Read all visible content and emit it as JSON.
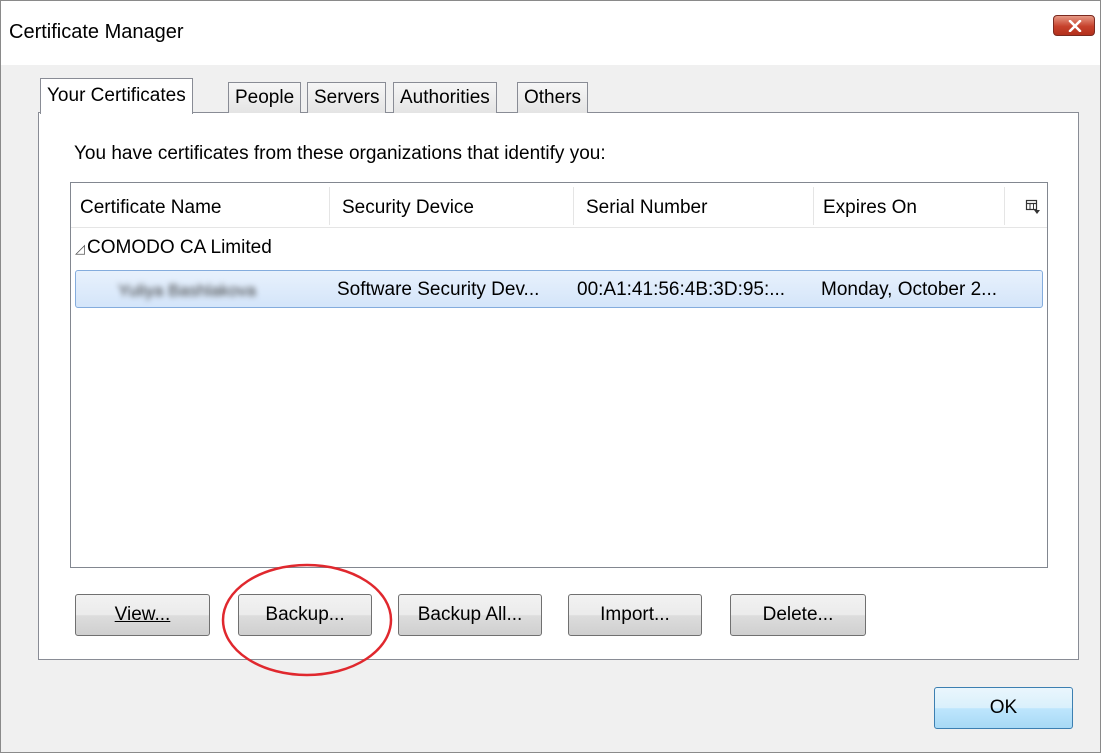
{
  "window": {
    "title": "Certificate Manager"
  },
  "tabs": [
    {
      "label": "Your Certificates",
      "active": true
    },
    {
      "label": "People",
      "active": false
    },
    {
      "label": "Servers",
      "active": false
    },
    {
      "label": "Authorities",
      "active": false
    },
    {
      "label": "Others",
      "active": false
    }
  ],
  "intro_text": "You have certificates from these organizations that identify you:",
  "table": {
    "columns": [
      "Certificate Name",
      "Security Device",
      "Serial Number",
      "Expires On"
    ],
    "groups": [
      {
        "name": "COMODO CA Limited",
        "expanded": true,
        "rows": [
          {
            "certificate_name": "Yuliya Bashlakova",
            "certificate_name_obscured": true,
            "security_device": "Software Security Dev...",
            "serial_number": "00:A1:41:56:4B:3D:95:...",
            "expires_on": "Monday, October 2...",
            "selected": true
          }
        ]
      }
    ]
  },
  "buttons": {
    "view": "View...",
    "backup": "Backup...",
    "backup_all": "Backup All...",
    "import": "Import...",
    "delete": "Delete...",
    "ok": "OK"
  },
  "colors": {
    "selection_fill": "#d9e7fa",
    "selection_border": "#84acdd",
    "annotation_ellipse": "#e0282e",
    "close_button": "#c6412c"
  },
  "icons": {
    "close": "close-x-icon",
    "column_picker": "column-picker-icon",
    "tree_toggle": "tree-expand-triangle-icon"
  }
}
